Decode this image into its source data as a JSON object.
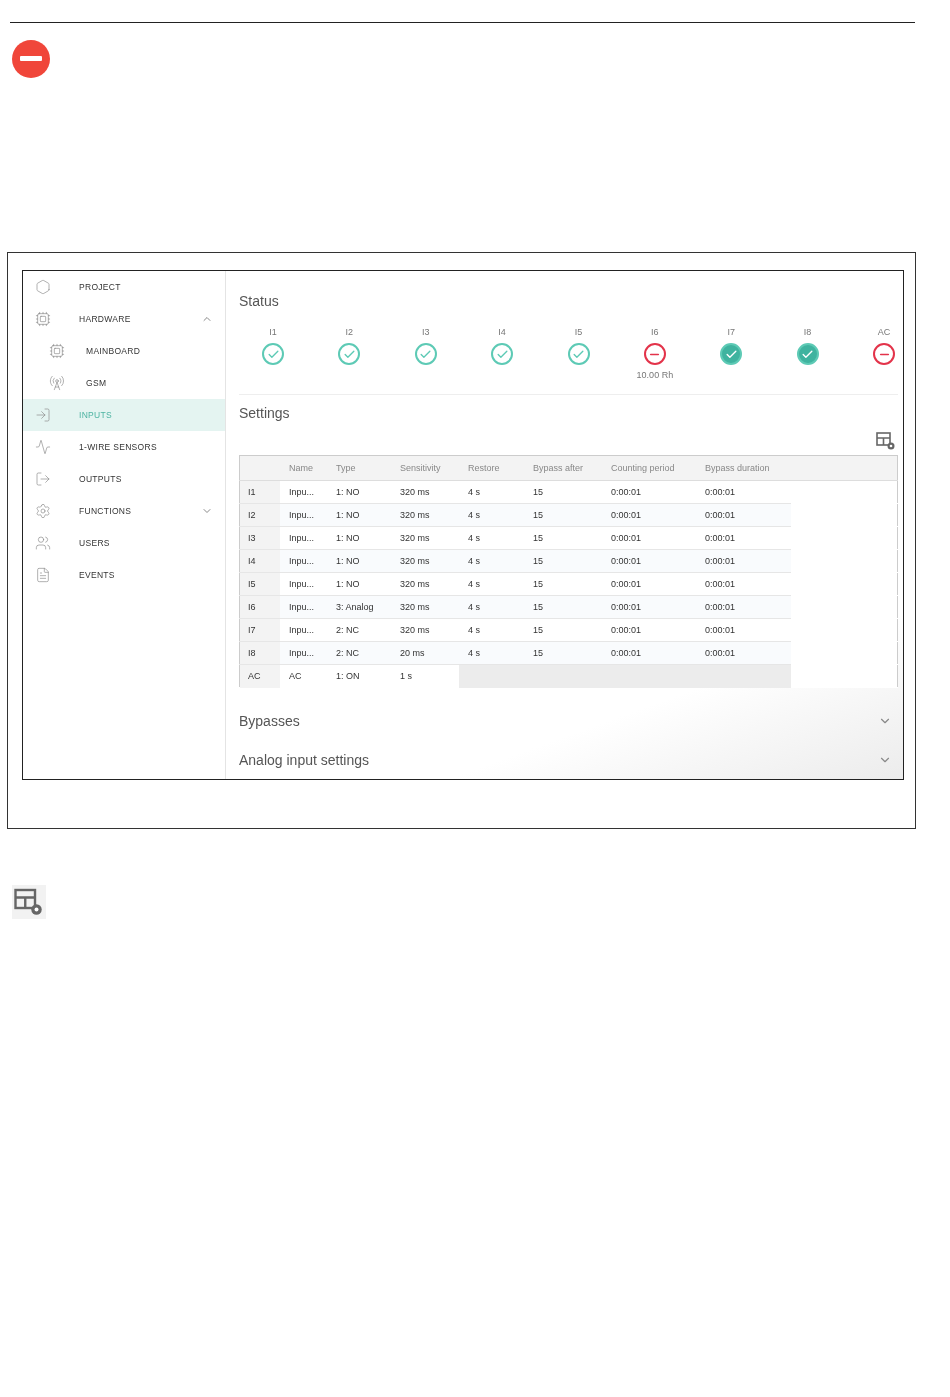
{
  "sidebar": {
    "items": [
      {
        "label": "PROJECT",
        "selected": false
      },
      {
        "label": "HARDWARE",
        "selected": false,
        "expanded": true,
        "children": [
          {
            "label": "MAINBOARD",
            "selected": false
          },
          {
            "label": "GSM",
            "selected": false
          }
        ]
      },
      {
        "label": "INPUTS",
        "selected": true
      },
      {
        "label": "1-WIRE SENSORS",
        "selected": false
      },
      {
        "label": "OUTPUTS",
        "selected": false
      },
      {
        "label": "FUNCTIONS",
        "selected": false,
        "expanded": false
      },
      {
        "label": "USERS",
        "selected": false
      },
      {
        "label": "EVENTS",
        "selected": false
      }
    ]
  },
  "status": {
    "title": "Status",
    "items": [
      {
        "label": "I1",
        "kind": "ok"
      },
      {
        "label": "I2",
        "kind": "ok"
      },
      {
        "label": "I3",
        "kind": "ok"
      },
      {
        "label": "I4",
        "kind": "ok"
      },
      {
        "label": "I5",
        "kind": "ok"
      },
      {
        "label": "I6",
        "kind": "alarm",
        "value": "10.00 Rh"
      },
      {
        "label": "I7",
        "kind": "active"
      },
      {
        "label": "I8",
        "kind": "active"
      },
      {
        "label": "AC",
        "kind": "alarm"
      }
    ]
  },
  "settings": {
    "title": "Settings",
    "table": {
      "columns": [
        "Name",
        "Type",
        "Sensitivity",
        "Restore",
        "Bypass after",
        "Counting period",
        "Bypass duration"
      ],
      "rows": [
        {
          "id": "I1",
          "cells": [
            "Inpu...",
            "1: NO",
            "320 ms",
            "4 s",
            "15",
            "0:00:01",
            "0:00:01"
          ]
        },
        {
          "id": "I2",
          "cells": [
            "Inpu...",
            "1: NO",
            "320 ms",
            "4 s",
            "15",
            "0:00:01",
            "0:00:01"
          ]
        },
        {
          "id": "I3",
          "cells": [
            "Inpu...",
            "1: NO",
            "320 ms",
            "4 s",
            "15",
            "0:00:01",
            "0:00:01"
          ]
        },
        {
          "id": "I4",
          "cells": [
            "Inpu...",
            "1: NO",
            "320 ms",
            "4 s",
            "15",
            "0:00:01",
            "0:00:01"
          ]
        },
        {
          "id": "I5",
          "cells": [
            "Inpu...",
            "1: NO",
            "320 ms",
            "4 s",
            "15",
            "0:00:01",
            "0:00:01"
          ]
        },
        {
          "id": "I6",
          "cells": [
            "Inpu...",
            "3: Analog",
            "320 ms",
            "4 s",
            "15",
            "0:00:01",
            "0:00:01"
          ]
        },
        {
          "id": "I7",
          "cells": [
            "Inpu...",
            "2: NC",
            "320 ms",
            "4 s",
            "15",
            "0:00:01",
            "0:00:01"
          ]
        },
        {
          "id": "I8",
          "cells": [
            "Inpu...",
            "2: NC",
            "20 ms",
            "4 s",
            "15",
            "0:00:01",
            "0:00:01"
          ]
        },
        {
          "id": "AC",
          "cells": [
            "AC",
            "1: ON",
            "1 s"
          ]
        }
      ]
    }
  },
  "sections": [
    {
      "title": "Bypasses",
      "expanded": false
    },
    {
      "title": "Analog input settings",
      "expanded": false
    }
  ]
}
